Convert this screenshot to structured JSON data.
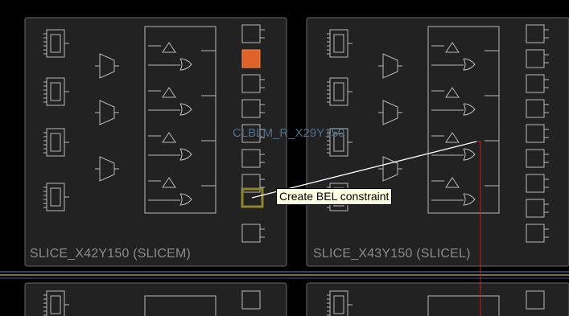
{
  "cell": {
    "label": "CLBLM_R_X29Y150"
  },
  "slices": [
    {
      "name": "SLICE_X42Y150 (SLICEM)"
    },
    {
      "name": "SLICE_X43Y150 (SLICEL)"
    }
  ],
  "tooltip": {
    "text": "Create BEL constraint"
  },
  "colors": {
    "background": "#000000",
    "slice_fill": "#222222",
    "slice_border": "#5a5a5a",
    "schematic": "#b8b8b8",
    "selected_bel": "#e0622a",
    "highlight_bel": "#8f8430",
    "route_net": "#cc1f1f",
    "drag_line": "#ffffff",
    "divider_blue": "#2c5f8f",
    "divider_yellow": "#a99a32"
  }
}
